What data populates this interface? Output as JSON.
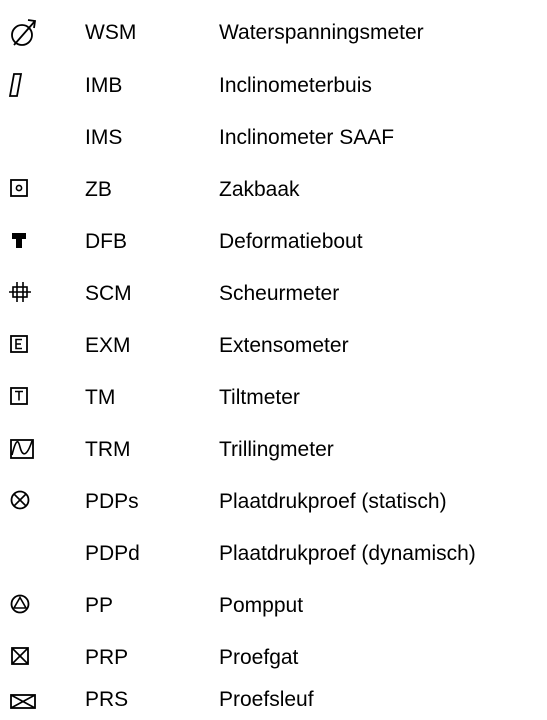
{
  "rows": [
    {
      "icon": "water-pressure-gauge-icon",
      "code": "WSM",
      "label": "Waterspanningsmeter"
    },
    {
      "icon": "inclinometer-tube-icon",
      "code": "IMB",
      "label": "Inclinometerbuis"
    },
    {
      "icon": "",
      "code": "IMS",
      "label": "Inclinometer SAAF"
    },
    {
      "icon": "settlement-plate-icon",
      "code": "ZB",
      "label": "Zakbaak"
    },
    {
      "icon": "deformation-bolt-icon",
      "code": "DFB",
      "label": "Deformatiebout"
    },
    {
      "icon": "crack-meter-icon",
      "code": "SCM",
      "label": "Scheurmeter"
    },
    {
      "icon": "extensometer-icon",
      "code": "EXM",
      "label": "Extensometer"
    },
    {
      "icon": "tiltmeter-icon",
      "code": "TM",
      "label": "Tiltmeter"
    },
    {
      "icon": "vibration-meter-icon",
      "code": "TRM",
      "label": "Trillingmeter"
    },
    {
      "icon": "circled-x-icon",
      "code": "PDPs",
      "label": "Plaatdrukproef (statisch)"
    },
    {
      "icon": "",
      "code": "PDPd",
      "label": "Plaatdrukproef (dynamisch)"
    },
    {
      "icon": "pump-well-icon",
      "code": "PP",
      "label": "Pompput"
    },
    {
      "icon": "test-pit-icon",
      "code": "PRP",
      "label": "Proefgat"
    },
    {
      "icon": "test-trench-icon",
      "code": "PRS",
      "label": "Proefsleuf"
    }
  ]
}
